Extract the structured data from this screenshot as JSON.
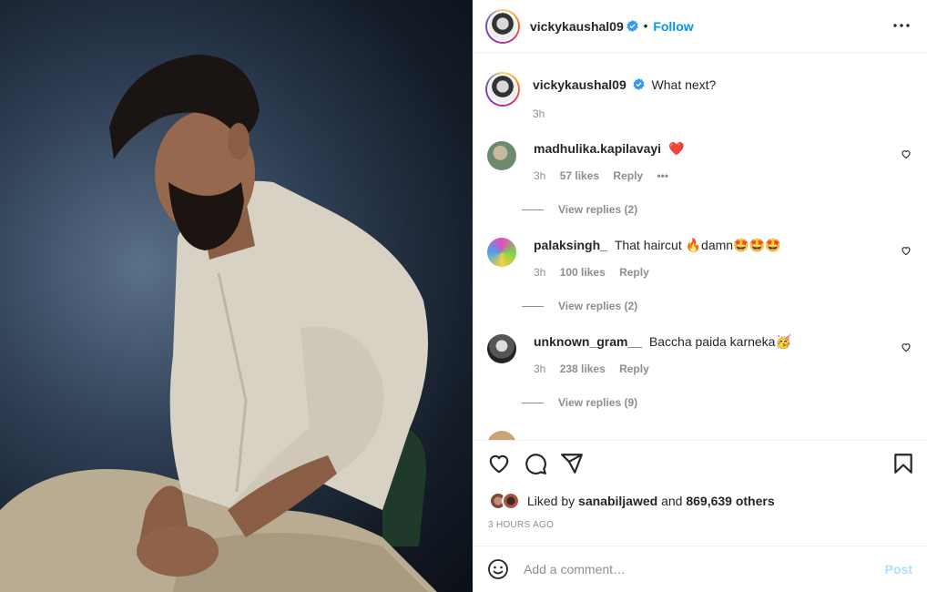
{
  "post": {
    "username": "vickykaushal09",
    "follow_label": "Follow",
    "dot": "•",
    "caption": "What next?",
    "caption_time": "3h"
  },
  "comments": [
    {
      "username": "madhulika.kapilavayi",
      "text": "",
      "emoji": "❤️",
      "time": "3h",
      "likes": "57 likes",
      "reply": "Reply",
      "more": "•••",
      "view_replies": "View replies (2)"
    },
    {
      "username": "palaksingh_",
      "text": "That haircut 🔥damn🤩🤩🤩",
      "time": "3h",
      "likes": "100 likes",
      "reply": "Reply",
      "view_replies": "View replies (2)"
    },
    {
      "username": "unknown_gram__",
      "text": "Baccha paida karneka🥳",
      "time": "3h",
      "likes": "238 likes",
      "reply": "Reply",
      "view_replies": "View replies (9)"
    }
  ],
  "likes": {
    "prefix": "Liked by",
    "user": "sanabiljawed",
    "and": "and",
    "count": "869,639 others"
  },
  "timestamp": "3 HOURS AGO",
  "comment_bar": {
    "placeholder": "Add a comment…",
    "post_label": "Post"
  },
  "colors": {
    "accent": "#0095f6",
    "verified": "#3897f0",
    "heart_red": "#ed4956",
    "post_disabled": "#b2dffc"
  },
  "icons": [
    "more-options-icon",
    "verified-badge-icon",
    "heart-icon",
    "comment-icon",
    "share-icon",
    "bookmark-icon",
    "emoji-icon"
  ]
}
